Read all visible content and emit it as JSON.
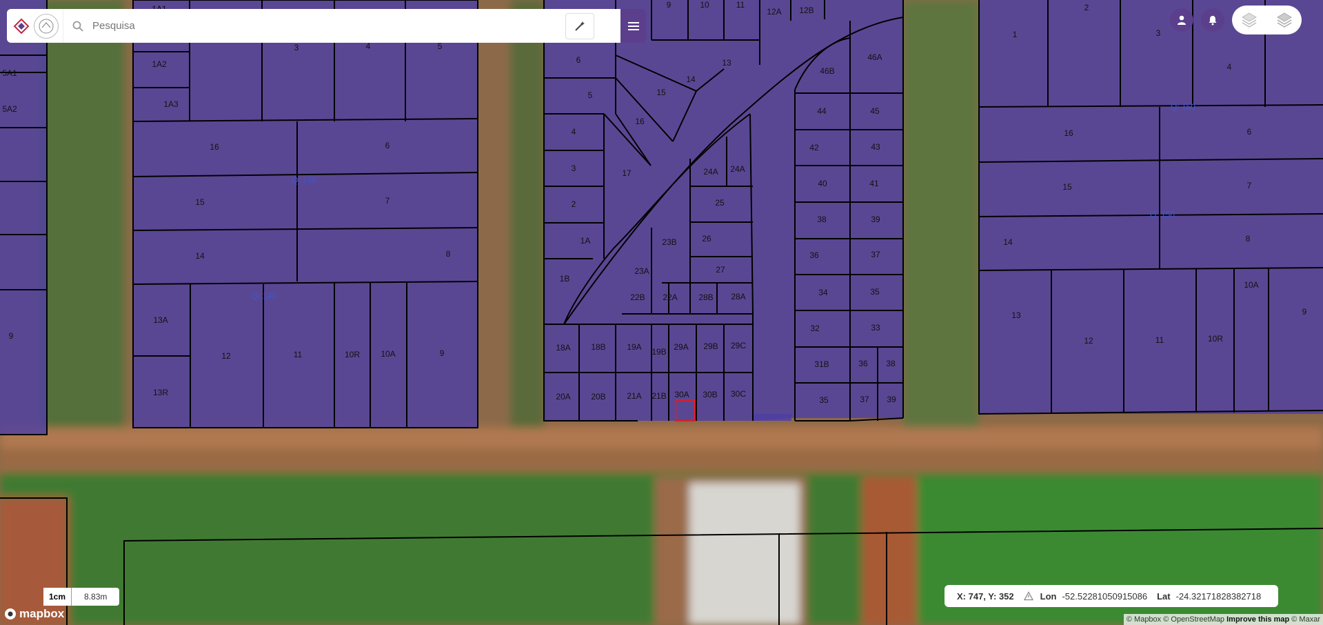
{
  "search": {
    "placeholder": "Pesquisa",
    "value": "Pesquisa"
  },
  "icons": {
    "search": "search-icon",
    "tool": "magic-wand-icon",
    "menu": "hamburger-menu-icon",
    "user": "user-icon",
    "bell": "bell-icon",
    "layers": "layers-icon"
  },
  "colors": {
    "brand": "#5b3f8c",
    "lot_fill": "#4b3ea8",
    "selection": "#e01c24"
  },
  "scale": {
    "left": "1cm",
    "right": "8.83m"
  },
  "coords": {
    "xy": "X: 747, Y: 352",
    "lon_label": "Lon",
    "lon_value": "-52.52281050915086",
    "lat_label": "Lat",
    "lat_value": "-24.32171828382718"
  },
  "mapbox_logo": "mapbox",
  "attribution": {
    "mapbox": "© Mapbox",
    "osm": "© OpenStreetMap",
    "improve": "Improve this map",
    "maxar": "© Maxar"
  },
  "quadras": [
    "Q: 148",
    "Q: 148",
    "Q: 150",
    "Q: 150"
  ],
  "lots": {
    "block_left_edge": [
      "1A1",
      "5A1",
      "5A2",
      "9"
    ],
    "block_a_top": [
      "1A1",
      "1A2",
      "1A3",
      "3",
      "4",
      "5"
    ],
    "block_a": [
      "16",
      "6",
      "15",
      "7",
      "14",
      "8",
      "13A",
      "13R",
      "12",
      "11",
      "10R",
      "10A",
      "9"
    ],
    "block_b_left": [
      "9",
      "10",
      "11",
      "6",
      "5",
      "4",
      "3",
      "2",
      "1A",
      "1B"
    ],
    "block_b_mid": [
      "12A",
      "12B",
      "13",
      "14",
      "15",
      "16",
      "17"
    ],
    "block_b_tri": [
      "24A",
      "24A",
      "25",
      "26",
      "27",
      "23B",
      "23A",
      "22B",
      "22A",
      "28B",
      "28A"
    ],
    "block_b_right": [
      "46B",
      "46A",
      "44",
      "45",
      "42",
      "43",
      "40",
      "41",
      "38",
      "39",
      "36",
      "37",
      "34",
      "35",
      "32",
      "33",
      "31B",
      "36",
      "38",
      "35",
      "37",
      "39"
    ],
    "block_b_bottom": [
      "18A",
      "18B",
      "19A",
      "19B",
      "29A",
      "29B",
      "29C",
      "20A",
      "20B",
      "21A",
      "21B",
      "30A",
      "30B",
      "30C"
    ],
    "block_c": [
      "1",
      "2",
      "3",
      "4",
      "16",
      "6",
      "15",
      "7",
      "14",
      "8",
      "13",
      "12",
      "11",
      "10R",
      "10A",
      "9"
    ]
  }
}
